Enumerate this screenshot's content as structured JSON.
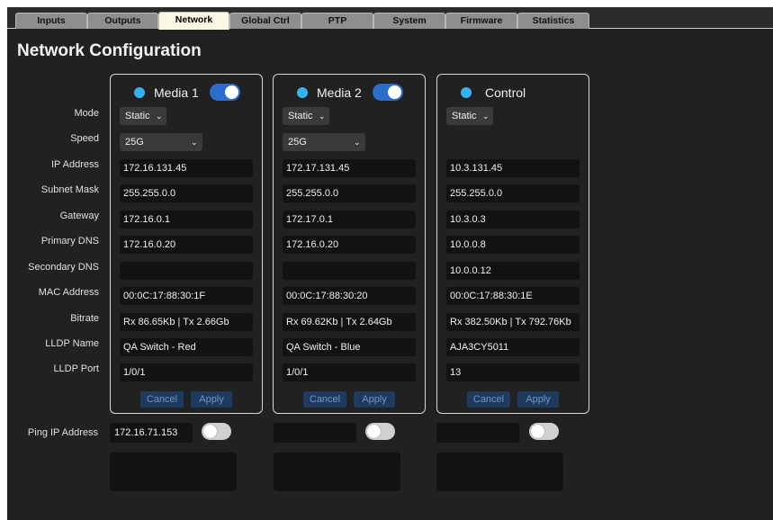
{
  "tabs": [
    "Inputs",
    "Outputs",
    "Network",
    "Global Ctrl",
    "PTP",
    "System",
    "Firmware",
    "Statistics"
  ],
  "active_tab": "Network",
  "page_title": "Network Configuration",
  "row_labels": {
    "mode": "Mode",
    "speed": "Speed",
    "ip": "IP Address",
    "subnet": "Subnet Mask",
    "gateway": "Gateway",
    "pdns": "Primary DNS",
    "sdns": "Secondary DNS",
    "mac": "MAC Address",
    "bitrate": "Bitrate",
    "lldp_name": "LLDP Name",
    "lldp_port": "LLDP Port"
  },
  "panels": [
    {
      "title": "Media 1",
      "enabled": true,
      "mode": "Static",
      "speed": "25G",
      "ip": "172.16.131.45",
      "subnet": "255.255.0.0",
      "gateway": "172.16.0.1",
      "pdns": "172.16.0.20",
      "sdns": "",
      "mac": "00:0C:17:88:30:1F",
      "bitrate": "Rx 86.65Kb | Tx 2.66Gb",
      "lldp_name": "QA Switch - Red",
      "lldp_port": "1/0/1",
      "cancel": "Cancel",
      "apply": "Apply"
    },
    {
      "title": "Media 2",
      "enabled": true,
      "mode": "Static",
      "speed": "25G",
      "ip": "172.17.131.45",
      "subnet": "255.255.0.0",
      "gateway": "172.17.0.1",
      "pdns": "172.16.0.20",
      "sdns": "",
      "mac": "00:0C:17:88:30:20",
      "bitrate": "Rx 69.62Kb | Tx 2.64Gb",
      "lldp_name": "QA Switch - Blue",
      "lldp_port": "1/0/1",
      "cancel": "Cancel",
      "apply": "Apply"
    },
    {
      "title": "Control",
      "mode": "Static",
      "ip": "10.3.131.45",
      "subnet": "255.255.0.0",
      "gateway": "10.3.0.3",
      "pdns": "10.0.0.8",
      "sdns": "10.0.0.12",
      "mac": "00:0C:17:88:30:1E",
      "bitrate": "Rx 382.50Kb | Tx 792.76Kb",
      "lldp_name": "AJA3CY5011",
      "lldp_port": "13",
      "cancel": "Cancel",
      "apply": "Apply"
    }
  ],
  "ping": {
    "label": "Ping IP Address",
    "values": [
      "172.16.71.153",
      "",
      ""
    ]
  },
  "icons": {
    "dropdown": "chevron-down-icon",
    "status": "status-led-icon"
  },
  "colors": {
    "background": "#212121",
    "accent": "#2a6dcc",
    "led": "#36b3ef",
    "active_tab": "#fbf8e4"
  }
}
